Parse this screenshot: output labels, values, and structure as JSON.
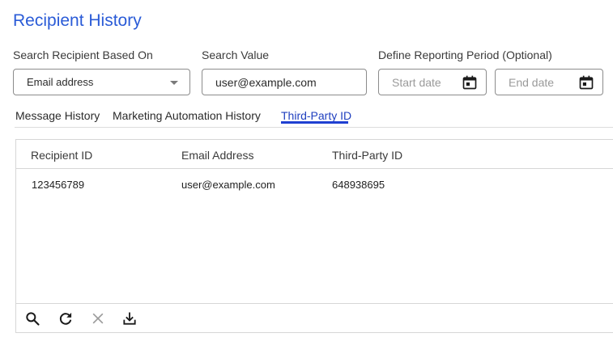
{
  "page": {
    "title": "Recipient History"
  },
  "filters": {
    "search_based_on_label": "Search Recipient Based On",
    "search_based_on_value": "Email address",
    "search_value_label": "Search Value",
    "search_value": "user@example.com",
    "period_label": "Define Reporting Period (Optional)",
    "start_placeholder": "Start date",
    "end_placeholder": "End date"
  },
  "tabs": [
    {
      "label": "Message History",
      "active": false
    },
    {
      "label": "Marketing Automation History",
      "active": false
    },
    {
      "label": "Third-Party ID",
      "active": true
    }
  ],
  "table": {
    "columns": [
      "Recipient ID",
      "Email Address",
      "Third-Party ID"
    ],
    "rows": [
      [
        "123456789",
        "user@example.com",
        "648938695"
      ]
    ]
  },
  "toolbar": {
    "icons": [
      "search-icon",
      "refresh-icon",
      "clear-icon",
      "download-icon"
    ]
  },
  "colors": {
    "accent": "#2a5bd7",
    "tab_underline": "#1f3fd1"
  }
}
